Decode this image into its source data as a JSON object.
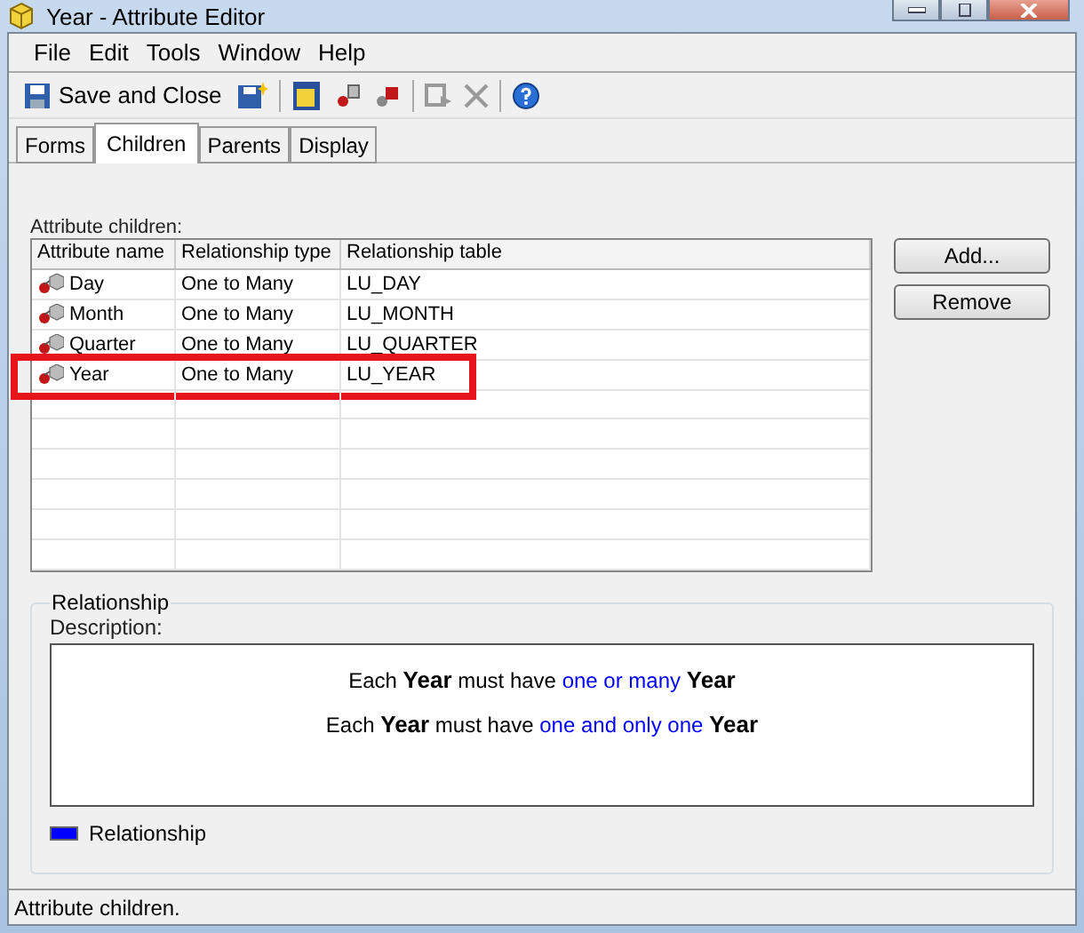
{
  "window": {
    "title": "Year - Attribute Editor"
  },
  "menu": [
    "File",
    "Edit",
    "Tools",
    "Window",
    "Help"
  ],
  "toolbar": {
    "save_label": "Save and Close"
  },
  "tabs": [
    {
      "label": "Forms",
      "selected": false
    },
    {
      "label": "Children",
      "selected": true
    },
    {
      "label": "Parents",
      "selected": false
    },
    {
      "label": "Display",
      "selected": false
    }
  ],
  "children_label": "Attribute children:",
  "table": {
    "columns": [
      "Attribute name",
      "Relationship type",
      "Relationship table"
    ],
    "rows": [
      {
        "cells": [
          "Day",
          "One to Many",
          "LU_DAY"
        ],
        "highlighted": false
      },
      {
        "cells": [
          "Month",
          "One to Many",
          "LU_MONTH"
        ],
        "highlighted": false
      },
      {
        "cells": [
          "Quarter",
          "One to Many",
          "LU_QUARTER"
        ],
        "highlighted": false
      },
      {
        "cells": [
          "Year",
          "One to Many",
          "LU_YEAR"
        ],
        "highlighted": true
      }
    ]
  },
  "buttons": [
    "Add...",
    "Remove"
  ],
  "relationship": {
    "title": "Relationship",
    "description_label": "Description:",
    "sentences": [
      [
        {
          "text": "Each ",
          "kind": "plain"
        },
        {
          "text": "Year",
          "kind": "bold"
        },
        {
          "text": " must have ",
          "kind": "plain"
        },
        {
          "text": "one or many",
          "kind": "link"
        },
        {
          "text": " Year",
          "kind": "bold"
        }
      ],
      [
        {
          "text": "Each ",
          "kind": "plain"
        },
        {
          "text": "Year",
          "kind": "bold"
        },
        {
          "text": " must have ",
          "kind": "plain"
        },
        {
          "text": "one and only one",
          "kind": "link"
        },
        {
          "text": " Year",
          "kind": "bold"
        }
      ]
    ],
    "legend": "Relationship"
  },
  "status_bar": "Attribute children."
}
